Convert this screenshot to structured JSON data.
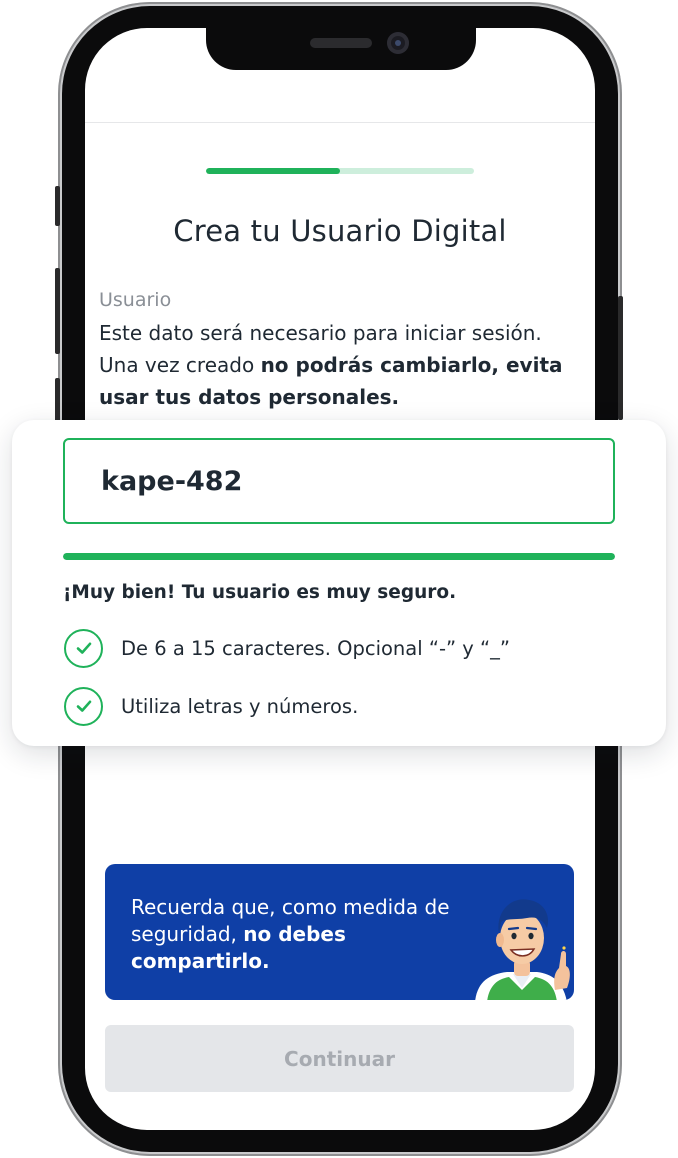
{
  "progress": {
    "step_fraction": 0.5
  },
  "title": "Crea tu Usuario Digital",
  "field": {
    "label": "Usuario",
    "helper_plain_1": "Este dato será necesario para iniciar sesión. Una vez creado ",
    "helper_bold": "no podrás cambiarlo, evita usar tus datos personales."
  },
  "input": {
    "value": "kape-482"
  },
  "strength": {
    "fraction": 1.0,
    "message": "¡Muy bien! Tu usuario es muy seguro.",
    "rules": [
      {
        "text": "De 6 a 15 caracteres. Opcional “-” y “_”",
        "ok": true
      },
      {
        "text": "Utiliza letras y números.",
        "ok": true
      }
    ]
  },
  "banner": {
    "text_plain": "Recuerda que, como medida de seguridad, ",
    "text_bold": "no debes compartirlo."
  },
  "continue_label": "Continuar",
  "colors": {
    "accent_green": "#1fb25a",
    "banner_blue": "#0f3fa6",
    "disabled_bg": "#e4e6e9",
    "disabled_text": "#a7abb1"
  }
}
